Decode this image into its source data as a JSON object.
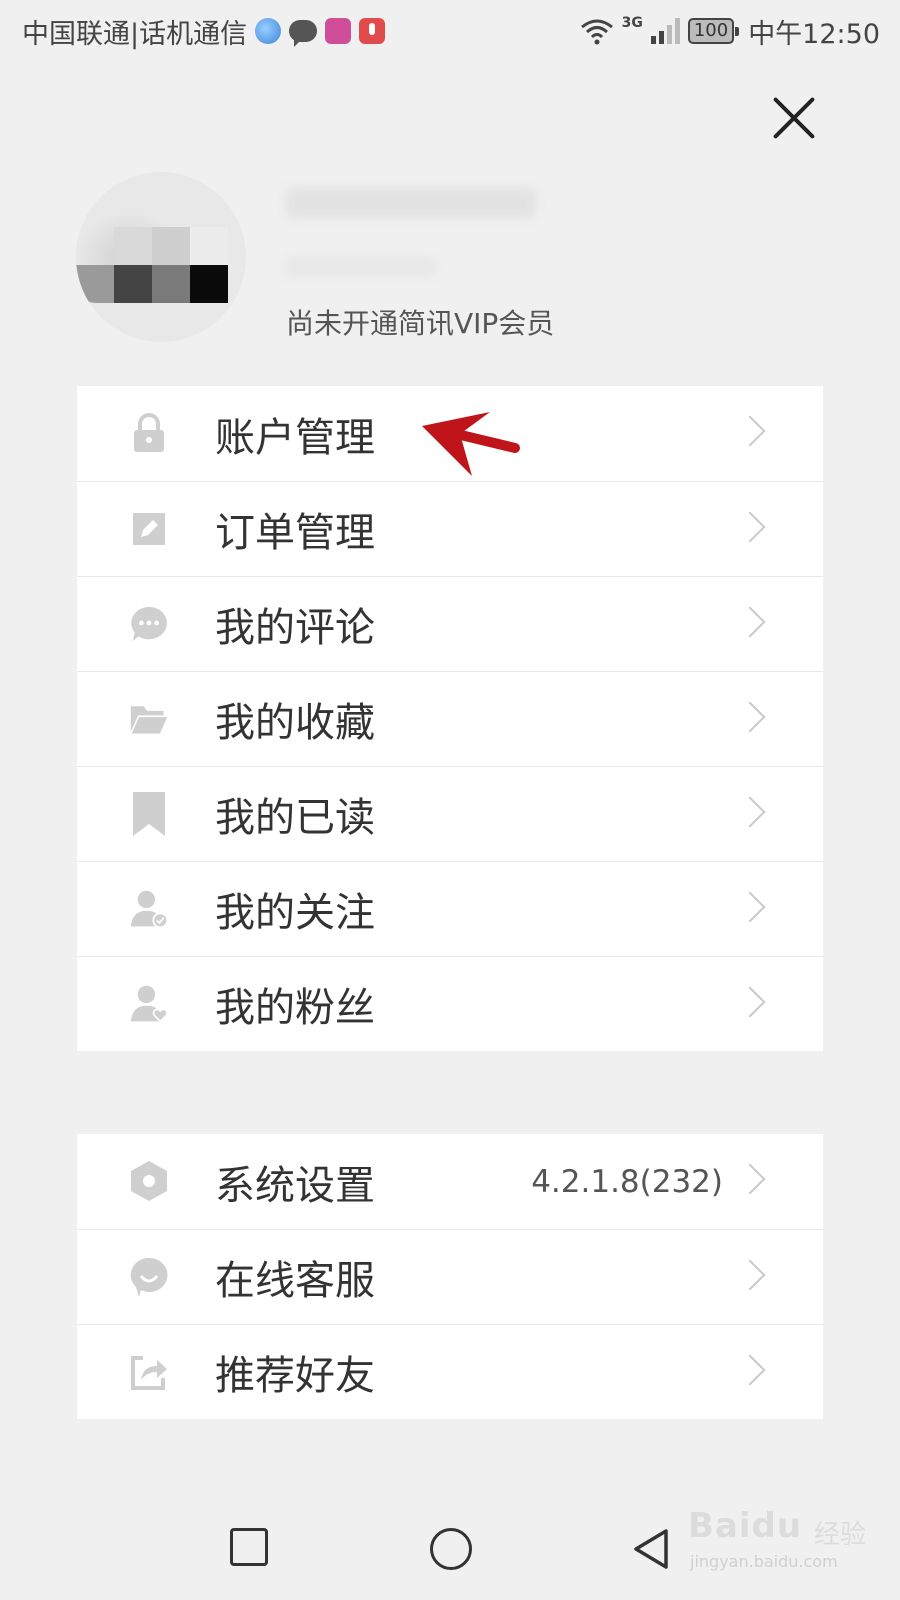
{
  "status_bar": {
    "carrier": "中国联通|话机通信",
    "network_type": "3G",
    "battery": "100",
    "time": "中午12:50"
  },
  "profile": {
    "vip_status": "尚未开通简讯VIP会员"
  },
  "menu_group_1": [
    {
      "name": "account",
      "icon": "lock-icon",
      "label": "账户管理"
    },
    {
      "name": "orders",
      "icon": "edit-icon",
      "label": "订单管理"
    },
    {
      "name": "comments",
      "icon": "chat-bubble-icon",
      "label": "我的评论"
    },
    {
      "name": "favorites",
      "icon": "folder-icon",
      "label": "我的收藏"
    },
    {
      "name": "read",
      "icon": "bookmark-icon",
      "label": "我的已读"
    },
    {
      "name": "following",
      "icon": "user-check-icon",
      "label": "我的关注"
    },
    {
      "name": "fans",
      "icon": "user-heart-icon",
      "label": "我的粉丝"
    }
  ],
  "menu_group_2": [
    {
      "name": "settings",
      "icon": "hexagon-settings-icon",
      "label": "系统设置",
      "value": "4.2.1.8(232)"
    },
    {
      "name": "support",
      "icon": "smiley-chat-icon",
      "label": "在线客服"
    },
    {
      "name": "recommend",
      "icon": "share-icon",
      "label": "推荐好友"
    }
  ],
  "watermark": {
    "logo": "Baidu",
    "suffix": "经验",
    "url": "jingyan.baidu.com"
  },
  "colors": {
    "background": "#f0f0f0",
    "annotation_arrow": "#c0141b"
  }
}
